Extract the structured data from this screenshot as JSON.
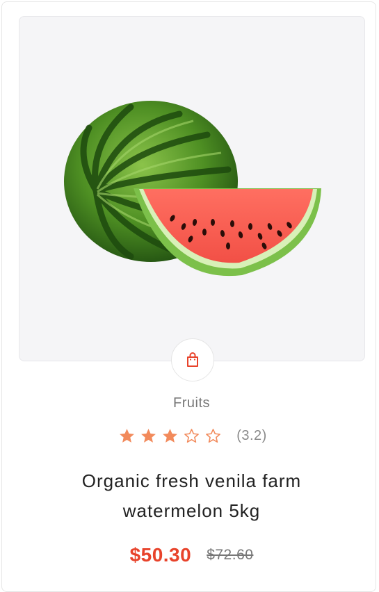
{
  "product": {
    "image_alt": "watermelon",
    "category": "Fruits",
    "rating_value": 3.2,
    "rating_text": "(3.2)",
    "stars_filled": 3,
    "stars_total": 5,
    "title": "Organic fresh venila farm watermelon 5kg",
    "price": "$50.30",
    "old_price": "$72.60"
  },
  "icons": {
    "cart": "shopping-bag-icon",
    "star": "star-icon"
  },
  "colors": {
    "accent": "#e8432b",
    "star": "#f28a5b",
    "text": "#222222",
    "muted": "#777777",
    "panel": "#f5f5f7"
  }
}
